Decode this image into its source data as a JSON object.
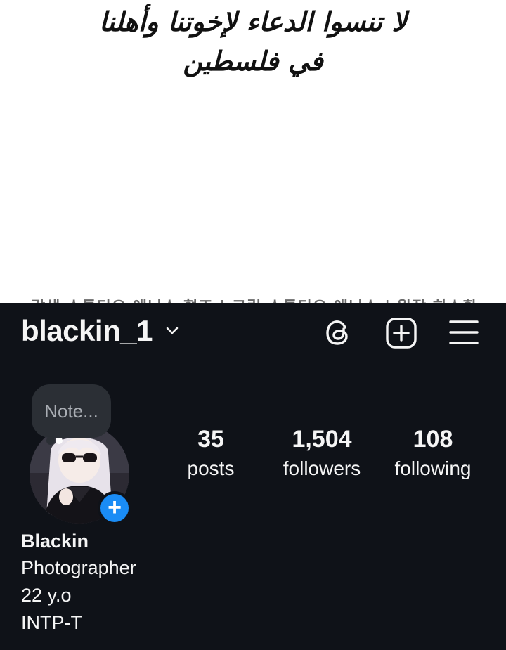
{
  "banner": {
    "line1": "لا تنسوا الدعاء لإخوتنا وأهلنا",
    "line2": "في فلسطين",
    "credits": "각색 스튜디오 애니스 협조 | 그림 스튜디오 애니스 | 원작 하스환"
  },
  "header": {
    "username": "blackin_1",
    "icons": [
      "chevron-down-icon",
      "threads-icon",
      "add-post-icon",
      "menu-icon"
    ]
  },
  "note": {
    "placeholder": "Note..."
  },
  "stats": {
    "posts": {
      "value": "35",
      "label": "posts"
    },
    "followers": {
      "value": "1,504",
      "label": "followers"
    },
    "following": {
      "value": "108",
      "label": "following"
    }
  },
  "bio": {
    "name": "Blackin",
    "lines": [
      "Photographer",
      "22 y.o",
      "INTP-T"
    ]
  },
  "colors": {
    "background": "#0f1218",
    "text": "#f5f5f5",
    "note_bubble": "#2b2f35",
    "accent_blue": "#1a8cf5"
  }
}
